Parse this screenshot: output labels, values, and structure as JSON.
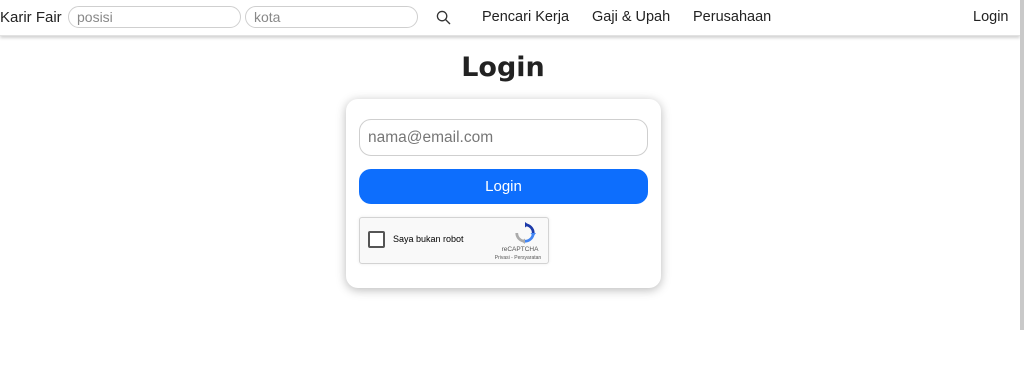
{
  "header": {
    "brand": "Karir Fair",
    "position_placeholder": "posisi",
    "city_placeholder": "kota",
    "search_icon": "search-icon",
    "nav": {
      "job_seekers": "Pencari Kerja",
      "salary": "Gaji & Upah",
      "companies": "Perusahaan",
      "login": "Login"
    }
  },
  "main": {
    "title": "Login",
    "email_placeholder": "nama@email.com",
    "login_button": "Login",
    "recaptcha": {
      "label": "Saya bukan robot",
      "brand": "reCAPTCHA",
      "privacy": "Privasi",
      "separator": " - ",
      "terms": "Persyaratan",
      "icon": "recaptcha-logo-icon"
    }
  },
  "colors": {
    "accent": "#0d6efd",
    "text": "#222222"
  }
}
